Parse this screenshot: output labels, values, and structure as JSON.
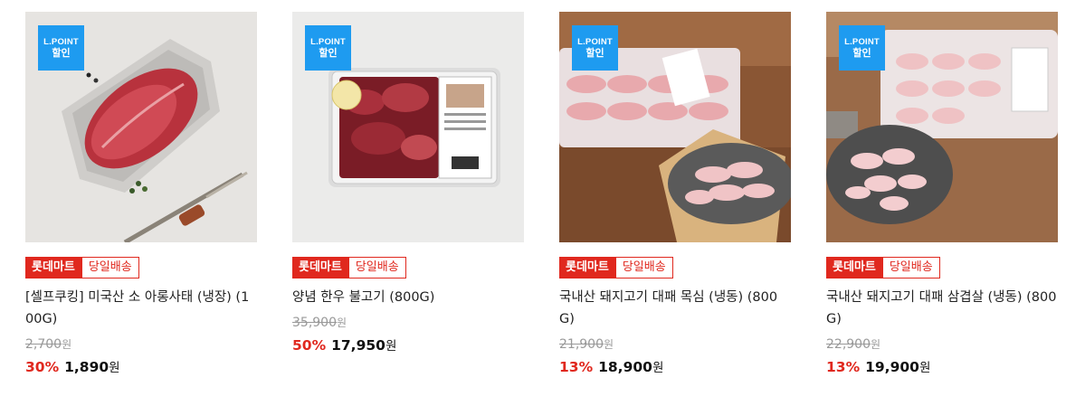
{
  "products": [
    {
      "image_desc": "raw beef shank on grey tray with fork",
      "lpoint_badge": {
        "line1": "L.POINT",
        "line2": "할인"
      },
      "mart_badge": "롯데마트",
      "shipping_badge": "당일배송",
      "title": "[셀프쿠킹] 미국산 소 아롱사태 (냉장) (100G)",
      "original_price": "2,700",
      "currency": "원",
      "discount": "30%",
      "sale_price": "1,890"
    },
    {
      "image_desc": "marinated hanwoo bulgogi in plastic pack",
      "lpoint_badge": {
        "line1": "L.POINT",
        "line2": "할인"
      },
      "mart_badge": "롯데마트",
      "shipping_badge": "당일배송",
      "title": "양념 한우 불고기 (800G)",
      "original_price": "35,900",
      "currency": "원",
      "discount": "50%",
      "sale_price": "17,950"
    },
    {
      "image_desc": "rolled pork neck slices in tray and on plate",
      "lpoint_badge": {
        "line1": "L.POINT",
        "line2": "할인"
      },
      "mart_badge": "롯데마트",
      "shipping_badge": "당일배송",
      "title": "국내산 돼지고기 대패 목심 (냉동) (800G)",
      "original_price": "21,900",
      "currency": "원",
      "discount": "13%",
      "sale_price": "18,900"
    },
    {
      "image_desc": "rolled pork belly slices in tray and on plate",
      "lpoint_badge": {
        "line1": "L.POINT",
        "line2": "할인"
      },
      "mart_badge": "롯데마트",
      "shipping_badge": "당일배송",
      "title": "국내산 돼지고기 대패 삼겹살 (냉동) (800G)",
      "original_price": "22,900",
      "currency": "원",
      "discount": "13%",
      "sale_price": "19,900"
    }
  ],
  "colors": {
    "accent_red": "#e0281e",
    "lpoint_blue": "#1e9bf0",
    "strike_gray": "#999999"
  }
}
